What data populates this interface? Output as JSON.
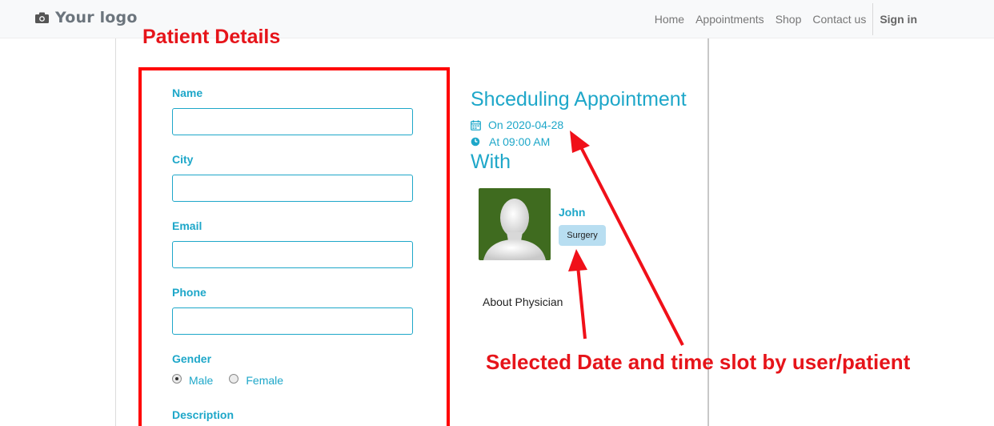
{
  "navbar": {
    "logo_text": "Your logo",
    "links": [
      "Home",
      "Appointments",
      "Shop",
      "Contact us"
    ],
    "signin": "Sign in"
  },
  "annotations": {
    "section_title": "Patient Details",
    "note": "Selected Date and time slot by user/patient",
    "color": "#e6141a"
  },
  "form": {
    "fields": [
      {
        "label": "Name",
        "value": ""
      },
      {
        "label": "City",
        "value": ""
      },
      {
        "label": "Email",
        "value": ""
      },
      {
        "label": "Phone",
        "value": ""
      }
    ],
    "gender": {
      "label": "Gender",
      "options": [
        "Male",
        "Female"
      ],
      "selected": "Male"
    },
    "description_label": "Description"
  },
  "appointment": {
    "title": "Shceduling Appointment",
    "date": "On 2020-04-28",
    "time": "At 09:00 AM",
    "with": "With",
    "physician": {
      "name": "John",
      "specialty": "Surgery",
      "about_label": "About Physician"
    }
  },
  "theme": {
    "accent": "#1ea7c9",
    "navbar_bg": "#f8f9fa",
    "avatar_bg": "#3f6b1f",
    "badge_bg": "#b8def1"
  }
}
